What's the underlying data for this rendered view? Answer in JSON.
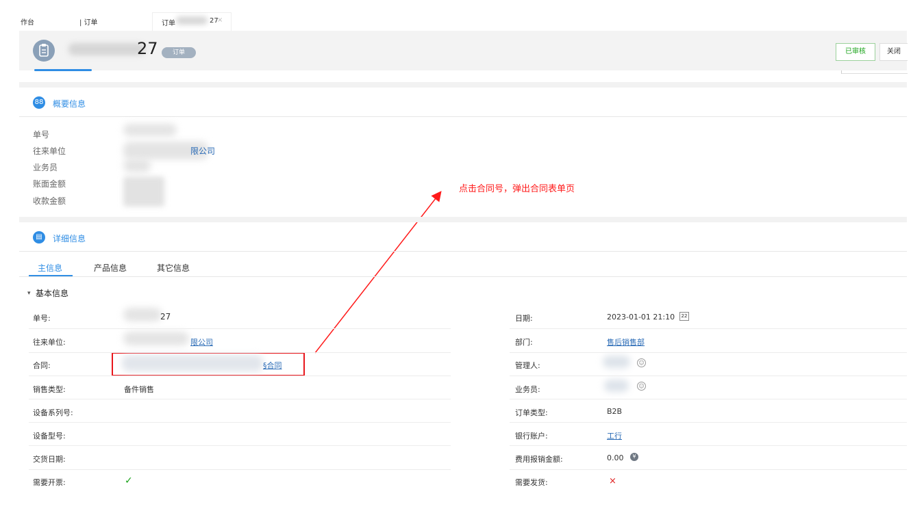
{
  "tabs": {
    "workbench": "作台",
    "orders": "| 订单",
    "current": "订单",
    "current_suffix": "27",
    "close_glyph": "×"
  },
  "header": {
    "order_suffix": "27",
    "badge": "订单",
    "approved_btn": "已审核",
    "close_btn": "关闭"
  },
  "overview": {
    "icon_glyph": "88",
    "title": "概要信息",
    "labels": [
      "单号",
      "往来单位",
      "业务员",
      "账面金额",
      "收款金额"
    ],
    "partner_tail": "限公司"
  },
  "annotation": {
    "text": "点击合同号，弹出合同表单页",
    "color": "#ff1a1a"
  },
  "detail": {
    "icon_glyph": "▤",
    "title": "详细信息",
    "tabs": [
      "主信息",
      "产品信息",
      "其它信息"
    ],
    "group_title": "基本信息",
    "left": [
      {
        "label": "单号:",
        "value": "27"
      },
      {
        "label": "往来单位:",
        "value": "限公司"
      },
      {
        "label": "合同:",
        "value": "§合同"
      },
      {
        "label": "销售类型:",
        "value": "备件销售"
      },
      {
        "label": "设备系列号:",
        "value": ""
      },
      {
        "label": "设备型号:",
        "value": ""
      },
      {
        "label": "交货日期:",
        "value": ""
      },
      {
        "label": "需要开票:",
        "value": "✓"
      }
    ],
    "right": [
      {
        "label": "日期:",
        "value": "2023-01-01 21:10"
      },
      {
        "label": "部门:",
        "value": "售后销售部"
      },
      {
        "label": "管理人:",
        "value": ""
      },
      {
        "label": "业务员:",
        "value": ""
      },
      {
        "label": "订单类型:",
        "value": "B2B"
      },
      {
        "label": "银行账户:",
        "value": "工行"
      },
      {
        "label": "费用报销金额:",
        "value": "0.00"
      },
      {
        "label": "需要发货:",
        "value": "×"
      }
    ]
  },
  "colors": {
    "accent": "#2f8de4",
    "link": "#2a6bb6",
    "check": "#1aa31a",
    "cross": "#e02020"
  }
}
